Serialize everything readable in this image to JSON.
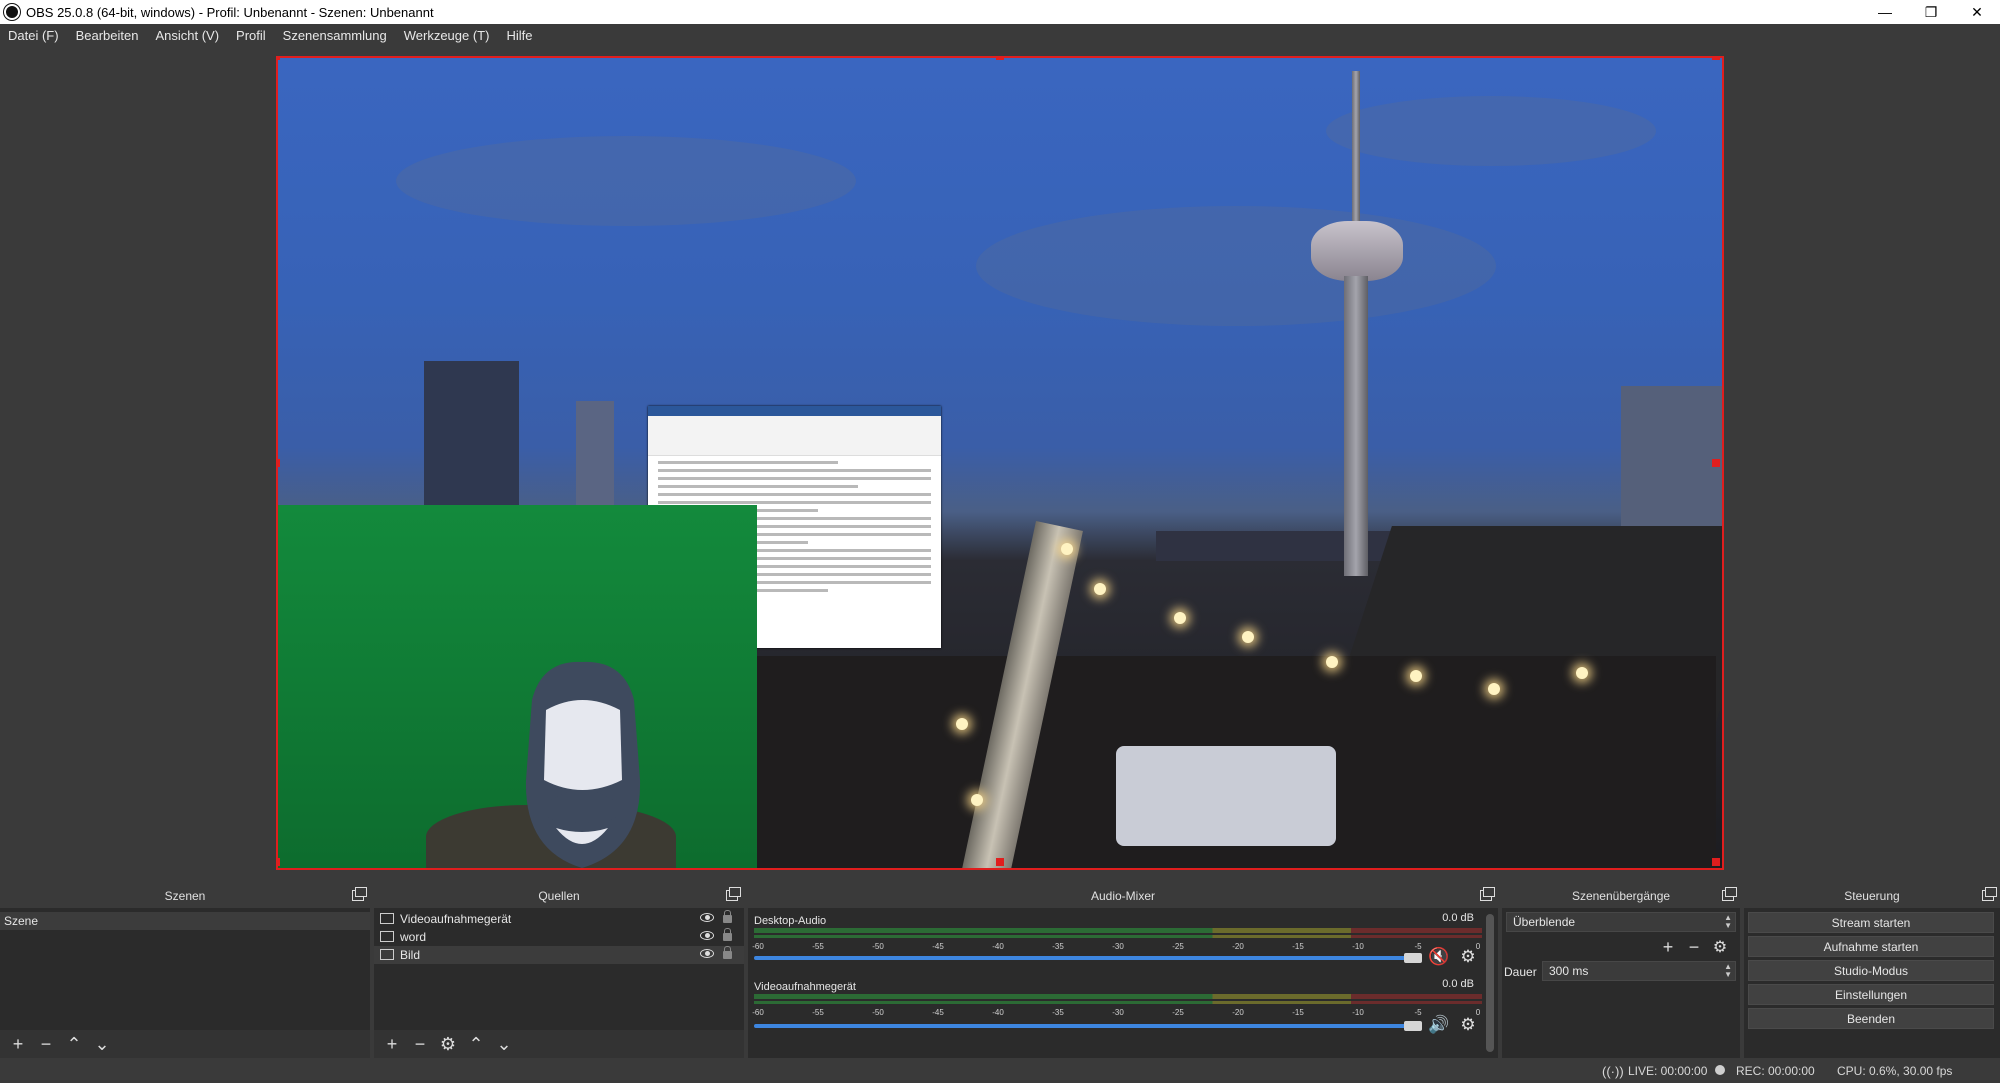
{
  "window": {
    "title": "OBS 25.0.8 (64-bit, windows) - Profil: Unbenannt - Szenen: Unbenannt",
    "minimize": "—",
    "maximize": "❐",
    "close": "✕"
  },
  "menu": [
    "Datei (F)",
    "Bearbeiten",
    "Ansicht (V)",
    "Profil",
    "Szenensammlung",
    "Werkzeuge (T)",
    "Hilfe"
  ],
  "docks": {
    "scenes": {
      "title": "Szenen",
      "items": [
        "Szene"
      ]
    },
    "sources": {
      "title": "Quellen",
      "items": [
        {
          "name": "Videoaufnahmegerät",
          "icon": "camera-icon"
        },
        {
          "name": "word",
          "icon": "window-capture-icon"
        },
        {
          "name": "Bild",
          "icon": "image-icon"
        }
      ]
    },
    "mixer": {
      "title": "Audio-Mixer",
      "scale": [
        "-60",
        "-55",
        "-50",
        "-45",
        "-40",
        "-35",
        "-30",
        "-25",
        "-20",
        "-15",
        "-10",
        "-5",
        "0"
      ],
      "channels": [
        {
          "name": "Desktop-Audio",
          "db": "0.0 dB",
          "muted": true,
          "volume": 1.0
        },
        {
          "name": "Videoaufnahmegerät",
          "db": "0.0 dB",
          "muted": false,
          "volume": 1.0
        }
      ]
    },
    "transitions": {
      "title": "Szenenübergänge",
      "selected": "Überblende",
      "duration_label": "Dauer",
      "duration_value": "300 ms"
    },
    "controls": {
      "title": "Steuerung",
      "buttons": [
        "Stream starten",
        "Aufnahme starten",
        "Studio-Modus",
        "Einstellungen",
        "Beenden"
      ]
    }
  },
  "status": {
    "live": "LIVE: 00:00:00",
    "rec": "REC: 00:00:00",
    "cpu": "CPU: 0.6%, 30.00 fps"
  },
  "colors": {
    "selection": "#e01e1e",
    "fader": "#3d86e0",
    "mute": "#e02a2a"
  }
}
